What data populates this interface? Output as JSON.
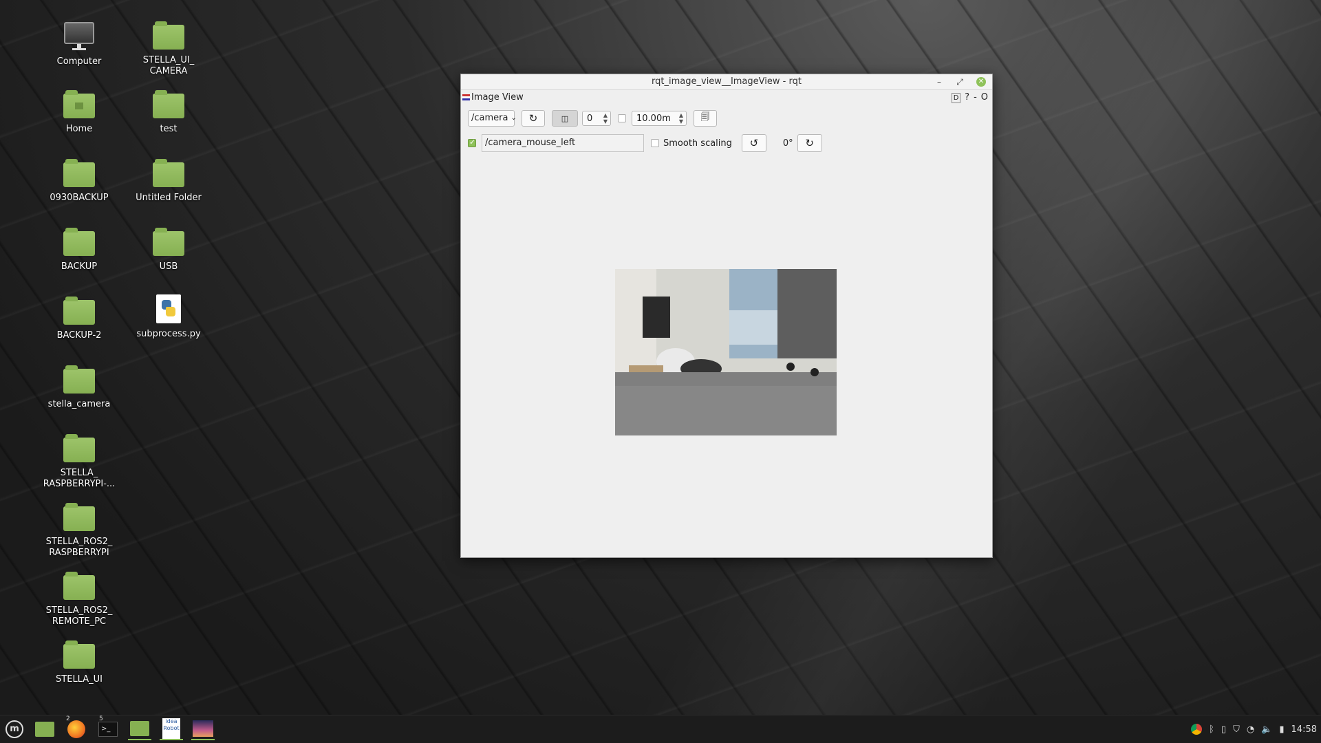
{
  "desktop": {
    "icons": [
      {
        "label": "Computer",
        "type": "computer"
      },
      {
        "label": "STELLA_UI_\nCAMERA",
        "type": "folder"
      },
      {
        "label": "Home",
        "type": "home"
      },
      {
        "label": "test",
        "type": "folder"
      },
      {
        "label": "0930BACKUP",
        "type": "folder"
      },
      {
        "label": "Untitled Folder",
        "type": "folder"
      },
      {
        "label": "BACKUP",
        "type": "folder"
      },
      {
        "label": "USB",
        "type": "folder"
      },
      {
        "label": "BACKUP-2",
        "type": "folder"
      },
      {
        "label": "subprocess.py",
        "type": "python-file"
      },
      {
        "label": "stella_camera",
        "type": "folder"
      },
      {
        "label": "STELLA_\nRASPBERRYPI-...",
        "type": "folder"
      },
      {
        "label": "STELLA_ROS2_\nRASPBERRYPI",
        "type": "folder"
      },
      {
        "label": "STELLA_ROS2_\nREMOTE_PC",
        "type": "folder"
      },
      {
        "label": "STELLA_UI",
        "type": "folder"
      }
    ]
  },
  "window": {
    "title": "rqt_image_view__ImageView - rqt",
    "minimize": "–",
    "maximize": "⤢",
    "close": "✕",
    "plugin_title": "Image View",
    "plugin_d": "D",
    "plugin_help": "?",
    "plugin_min": "-",
    "plugin_close": "O",
    "topic_combo": "/camera",
    "refresh_icon": "refresh-icon",
    "spin_value": "0",
    "duration_value": "10.00m",
    "mouse_topic_checked": true,
    "mouse_topic": "/camera_mouse_left",
    "smooth_scaling_label": "Smooth scaling",
    "smooth_scaling_checked": false,
    "rotation_label": "0°"
  },
  "taskbar": {
    "badge_firefox": "2",
    "badge_terminal": "5",
    "idea_label": "idea\nRobot",
    "clock": "14:58"
  }
}
